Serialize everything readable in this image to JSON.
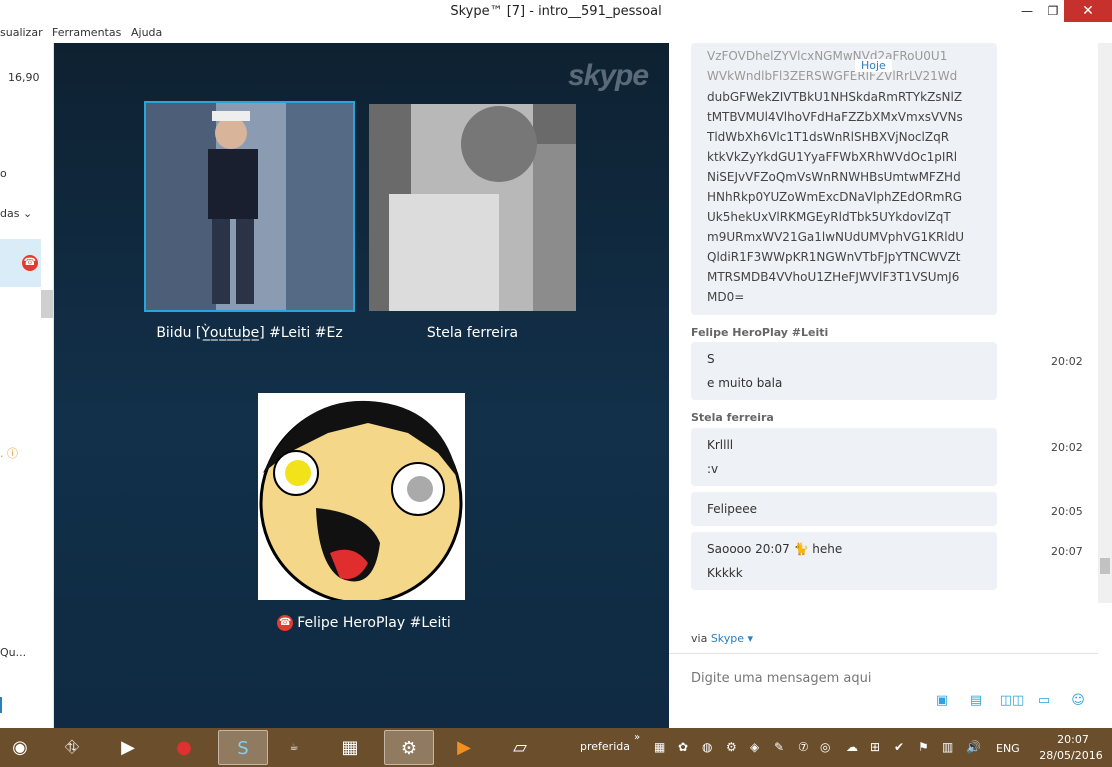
{
  "window": {
    "title": "Skype™ [7] - intro__591_pessoal",
    "minimize": "—",
    "maximize": "❐",
    "close": "✕"
  },
  "menu": [
    "sualizar",
    "Ferramentas",
    "Ajuda"
  ],
  "left_panel": {
    "balance": "16,90",
    "item_o": "o",
    "filter": "das",
    "item_q": "Qu..."
  },
  "call": {
    "participants": [
      {
        "name": "Biidu [Ỳ̲o̲u̲̲t̲u̲b̲e̲̲] #Leiti #Ez"
      },
      {
        "name": "Stela ferreira"
      },
      {
        "name": "Felipe HeroPlay #Leiti"
      }
    ],
    "logo": "skype"
  },
  "chat": {
    "date_divider": "Hoje",
    "code_lines": [
      "VzFOVDhelZYVlcxNGMwNVd2aFRoU0U1",
      "WVkWndlbFl3ZERSWGFERlFZVlRrLV21Wd",
      "dubGFWekZIVTBkU1NHSkdaRmRTYkZsNlZ",
      "tMTBVMUl4VlhoVFdHaFZZbXMxVmxsVVNs",
      "TldWbXh6Vlc1T1dsWnRlSHBXVjNoclZqR",
      "ktkVkZyYkdGU1YyaFFWbXRhWVdOc1pIRl",
      "NiSEJvVFZoQmVsWnRNWHBsUmtwMFZHd",
      "HNhRkp0YUZoWmExcDNaVlphZEdORmRG",
      "Uk5hekUxVlRKMGEyRldTbk5UYkdovlZqT",
      "m9URmxWV21Ga1lwNUdUMVphVG1KRldU",
      "QldiR1F3WWpKR1NGWnVTbFJpYTNCWVZt",
      "MTRSMDB4VVhoU1ZHeFJWVlF3T1VSUmJ6",
      "MD0="
    ],
    "messages": [
      {
        "sender": "Felipe HeroPlay #Leiti",
        "lines": [
          "S",
          "e muito bala"
        ],
        "time": "20:02"
      },
      {
        "sender": "Stela ferreira",
        "lines": [
          "Krllll",
          ":v"
        ],
        "time": "20:02"
      },
      {
        "sender": "",
        "lines": [
          "Felipeee"
        ],
        "time": "20:05"
      },
      {
        "sender": "",
        "lines": [
          "Saoooo 20:07 🐈 hehe",
          "Kkkkk"
        ],
        "time": "20:07"
      }
    ],
    "via_prefix": "via",
    "via_link": "Skype ▾",
    "input_placeholder": "Digite uma mensagem aqui"
  },
  "taskbar": {
    "toolbar_label": "preferida",
    "language": "ENG",
    "time": "20:07",
    "date": "28/05/2016"
  },
  "colors": {
    "video_bg": "#0f2a42",
    "accent": "#2aa5dc",
    "taskbar": "#6b4e2b",
    "close": "#c7312d"
  }
}
